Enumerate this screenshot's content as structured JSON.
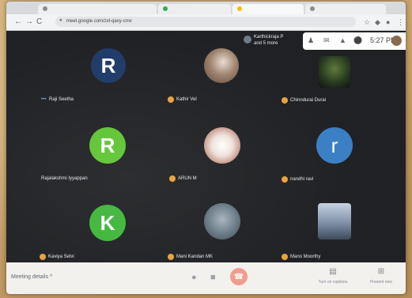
{
  "browser": {
    "url": "meet.google.com/zxl-qaxy-cmx",
    "nav": {
      "back": "←",
      "forward": "→",
      "reload": "C"
    }
  },
  "meeting": {
    "presenter_line1": "Karthickraja P",
    "presenter_line2": "and 5 more",
    "time": "5:27 PM",
    "meeting_details_label": "Meeting details",
    "captions_label": "Turn on captions",
    "present_label": "Present now"
  },
  "participants": [
    {
      "name": "Raji Seetha",
      "avatar_letter": "R",
      "avatar_color": "#1f3a68"
    },
    {
      "name": "Kathir Vel",
      "avatar_letter": "",
      "avatar_color": "#7a5a48"
    },
    {
      "name": "Chinndurai Durai",
      "avatar_letter": "",
      "avatar_color": "#2e4a2a"
    },
    {
      "name": "Rajalakshmi Iyyappan",
      "avatar_letter": "R",
      "avatar_color": "#5fc433"
    },
    {
      "name": "ARUN M",
      "avatar_letter": "",
      "avatar_color": "#e9d8d0"
    },
    {
      "name": "nandhi ravi",
      "avatar_letter": "r",
      "avatar_color": "#3a7fc4"
    },
    {
      "name": "Kaviya Selvi",
      "avatar_letter": "K",
      "avatar_color": "#3fb63a"
    },
    {
      "name": "Mani Kandan MK",
      "avatar_letter": "",
      "avatar_color": "#6d7e8a"
    },
    {
      "name": "Mano Moorthy",
      "avatar_letter": "",
      "avatar_color": "#7e8fa6"
    }
  ],
  "icons": {
    "mic": "microphone-icon",
    "camera": "camera-icon",
    "end_call": "end-call-icon",
    "captions": "captions-icon",
    "present": "present-icon"
  }
}
